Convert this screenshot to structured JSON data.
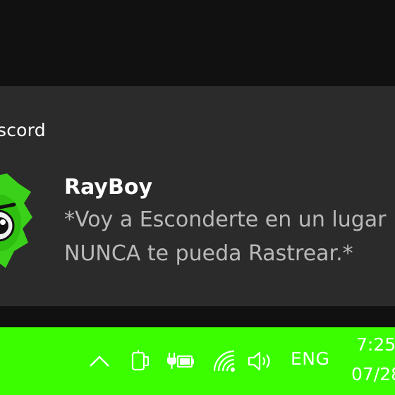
{
  "notification": {
    "app_name": "scord",
    "sender": "RayBoy",
    "message_line1": "*Voy a Esconderte en un lugar",
    "message_line2": "NUNCA te pueda Rastrear.*"
  },
  "taskbar": {
    "background": "#3bff00",
    "language": "ENG",
    "time": "7:25",
    "date": "07/28",
    "tray_icons": [
      "chevron-up-icon",
      "device-icon",
      "power-plug-battery-icon",
      "wifi-icon",
      "volume-icon"
    ]
  },
  "colors": {
    "toast_background": "#2b2b2b",
    "desktop_background": "#111111",
    "avatar_green": "#3bd11a"
  }
}
